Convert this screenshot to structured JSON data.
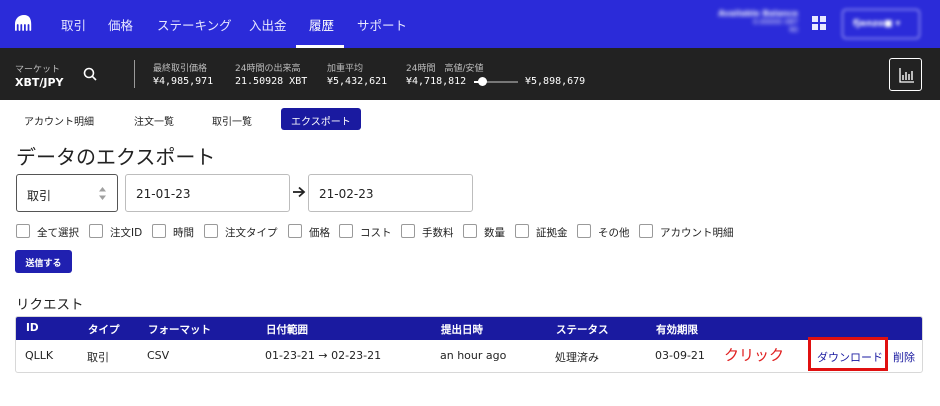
{
  "nav": {
    "items": [
      "取引",
      "価格",
      "ステーキング",
      "入出金",
      "履歴",
      "サポート"
    ],
    "active": "履歴",
    "balance_label": "Available Balance",
    "balance_value": "0.00000 XBT",
    "balance_sub": "¥0",
    "user": "fjenzo■ ▾"
  },
  "market": {
    "label": "マーケット",
    "pair": "XBT/JPY",
    "stats": [
      {
        "label": "最終取引価格",
        "value": "¥4,985,971"
      },
      {
        "label": "24時間の出来高",
        "value": "21.50928 XBT"
      },
      {
        "label": "加重平均",
        "value": "¥5,432,621"
      },
      {
        "label": "24時間　高値/安値",
        "value": "¥4,718,812"
      }
    ],
    "high": "¥5,898,679",
    "range_position": 0.2
  },
  "tabs": [
    "アカウント明細",
    "注文一覧",
    "取引一覧",
    "エクスポート"
  ],
  "page_title": "データのエクスポート",
  "form": {
    "type_value": "取引",
    "date_from": "21-01-23",
    "date_to": "21-02-23",
    "checkboxes": [
      "全て選択",
      "注文ID",
      "時間",
      "注文タイプ",
      "価格",
      "コスト",
      "手数料",
      "数量",
      "証拠金",
      "その他",
      "アカウント明細"
    ],
    "submit_label": "送信する"
  },
  "requests": {
    "title": "リクエスト",
    "headers": [
      "ID",
      "タイプ",
      "フォーマット",
      "日付範囲",
      "提出日時",
      "ステータス",
      "有効期限"
    ],
    "row": {
      "id": "QLLK",
      "type": "取引",
      "format": "CSV",
      "range": "01-23-21 → 02-23-21",
      "submitted": "an hour ago",
      "status": "処理済み",
      "expires": "03-09-21"
    },
    "download_label": "ダウンロード",
    "delete_label": "削除"
  },
  "annotation": {
    "click_note": "クリック",
    "color": "#e01010"
  },
  "colors": {
    "nav_bg": "#2b2bd9",
    "market_bg": "#222222",
    "accent": "#1a1aa0"
  }
}
